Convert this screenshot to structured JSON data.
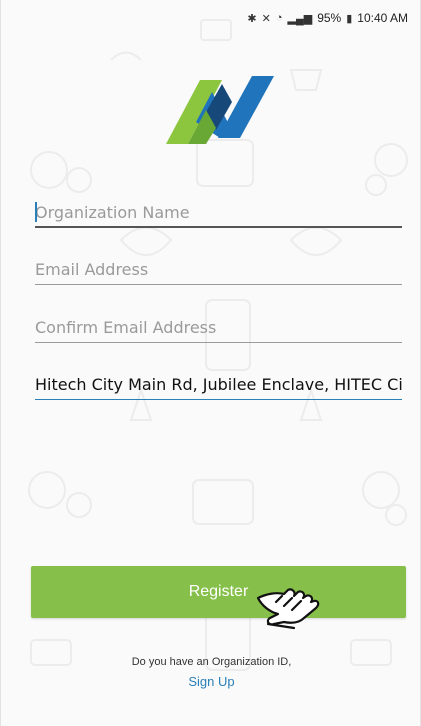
{
  "status_bar": {
    "battery": "95%",
    "time": "10:40 AM",
    "icons": [
      "bluetooth-icon",
      "mute-icon",
      "wifi-icon",
      "signal-icon",
      "battery-icon"
    ]
  },
  "form": {
    "organization_name": {
      "placeholder": "Organization Name",
      "value": ""
    },
    "email": {
      "placeholder": "Email Address",
      "value": ""
    },
    "confirm_email": {
      "placeholder": "Confirm Email Address",
      "value": ""
    },
    "address": {
      "placeholder": "",
      "value": "Hitech City Main Rd, Jubilee Enclave, HITEC Ci"
    }
  },
  "actions": {
    "register_label": "Register",
    "org_id_prompt": "Do you have an Organization ID,",
    "signup_label": "Sign Up"
  },
  "colors": {
    "accent_green": "#86c04a",
    "link_blue": "#2a7fb8",
    "logo_green": "#8cc63f",
    "logo_blue": "#1f74bb",
    "logo_dark_blue": "#17487a"
  }
}
